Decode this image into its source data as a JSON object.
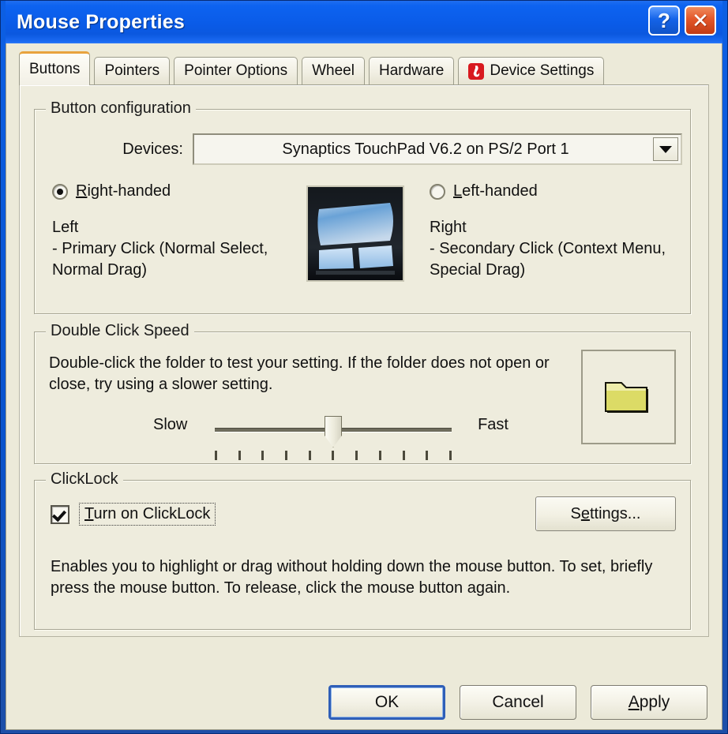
{
  "window": {
    "title": "Mouse Properties",
    "help_button": "?",
    "close_button": "✕",
    "title_bar_color": "#0a5be8",
    "body_color": "#ecead9"
  },
  "tabs": [
    {
      "label": "Buttons",
      "active": true,
      "icon": ""
    },
    {
      "label": "Pointers",
      "active": false,
      "icon": ""
    },
    {
      "label": "Pointer Options",
      "active": false,
      "icon": ""
    },
    {
      "label": "Wheel",
      "active": false,
      "icon": ""
    },
    {
      "label": "Hardware",
      "active": false,
      "icon": ""
    },
    {
      "label": "Device Settings",
      "active": false,
      "icon": "synaptics-flame-icon"
    }
  ],
  "button_configuration": {
    "group_title": "Button configuration",
    "devices_label": "Devices:",
    "device_selected": "Synaptics TouchPad V6.2 on PS/2 Port 1",
    "dropdown_icon": "chevron-down-icon",
    "right_handed": {
      "label": "Right-handed",
      "accel": "R",
      "selected": true,
      "description_title": "Left",
      "description": " - Primary Click (Normal Select, Normal Drag)"
    },
    "left_handed": {
      "label": "Left-handed",
      "accel": "L",
      "selected": false,
      "description_title": "Right",
      "description": " - Secondary Click (Context Menu, Special Drag)"
    },
    "preview_image": "touchpad-illustration"
  },
  "double_click_speed": {
    "group_title": "Double Click Speed",
    "description": "Double-click the folder to test your setting.  If the folder does not open or close, try using a slower setting.",
    "slider": {
      "min_label": "Slow",
      "max_label": "Fast",
      "value_percent": 50,
      "tick_count": 11
    },
    "test_target": "folder-icon"
  },
  "clicklock": {
    "group_title": "ClickLock",
    "checkbox_label": "Turn on ClickLock",
    "checkbox_accel": "T",
    "checked": true,
    "settings_button": "Settings...",
    "settings_accel": "e",
    "description": "Enables you to highlight or drag without holding down the mouse button.  To set, briefly press the mouse button.  To release, click the mouse button again."
  },
  "footer": {
    "ok": "OK",
    "cancel": "Cancel",
    "apply": "Apply",
    "apply_accel": "A",
    "default_button": "OK"
  }
}
